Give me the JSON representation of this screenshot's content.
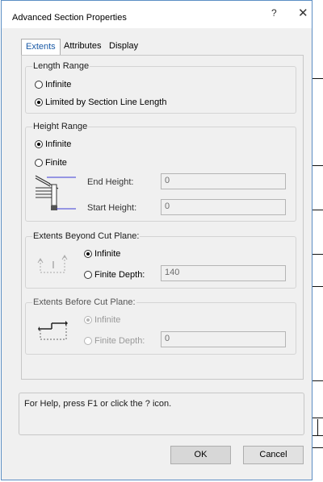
{
  "window": {
    "title": "Advanced Section Properties",
    "help_glyph": "?",
    "close_glyph": "✕"
  },
  "tabs": [
    {
      "label": "Extents",
      "active": true
    },
    {
      "label": "Attributes",
      "active": false
    },
    {
      "label": "Display",
      "active": false
    }
  ],
  "length_range": {
    "title": "Length Range",
    "options": [
      {
        "label": "Infinite",
        "checked": false
      },
      {
        "label": "Limited by Section Line Length",
        "checked": true
      }
    ]
  },
  "height_range": {
    "title": "Height Range",
    "options": [
      {
        "label": "Infinite",
        "checked": true
      },
      {
        "label": "Finite",
        "checked": false
      }
    ],
    "end_height": {
      "label": "End Height:",
      "value": "0"
    },
    "start_height": {
      "label": "Start Height:",
      "value": "0"
    }
  },
  "beyond_cut": {
    "title": "Extents Beyond Cut Plane:",
    "options": [
      {
        "label": "Infinite",
        "checked": true
      },
      {
        "label": "Finite Depth:",
        "checked": false
      }
    ],
    "finite_depth_value": "140"
  },
  "before_cut": {
    "title": "Extents Before Cut Plane:",
    "disabled": true,
    "options": [
      {
        "label": "Infinite",
        "checked": true
      },
      {
        "label": "Finite Depth:",
        "checked": false
      }
    ],
    "finite_depth_value": "0"
  },
  "help": {
    "text": "For Help, press F1 or click the ? icon."
  },
  "buttons": {
    "ok": "OK",
    "cancel": "Cancel"
  },
  "colors": {
    "accent": "#1a5aa6",
    "window_border": "#5b8ec4",
    "icon_blue": "#3a3ad6"
  },
  "icons": [
    "help-icon",
    "close-icon",
    "height-range-icon",
    "beyond-cut-icon",
    "before-cut-icon"
  ]
}
